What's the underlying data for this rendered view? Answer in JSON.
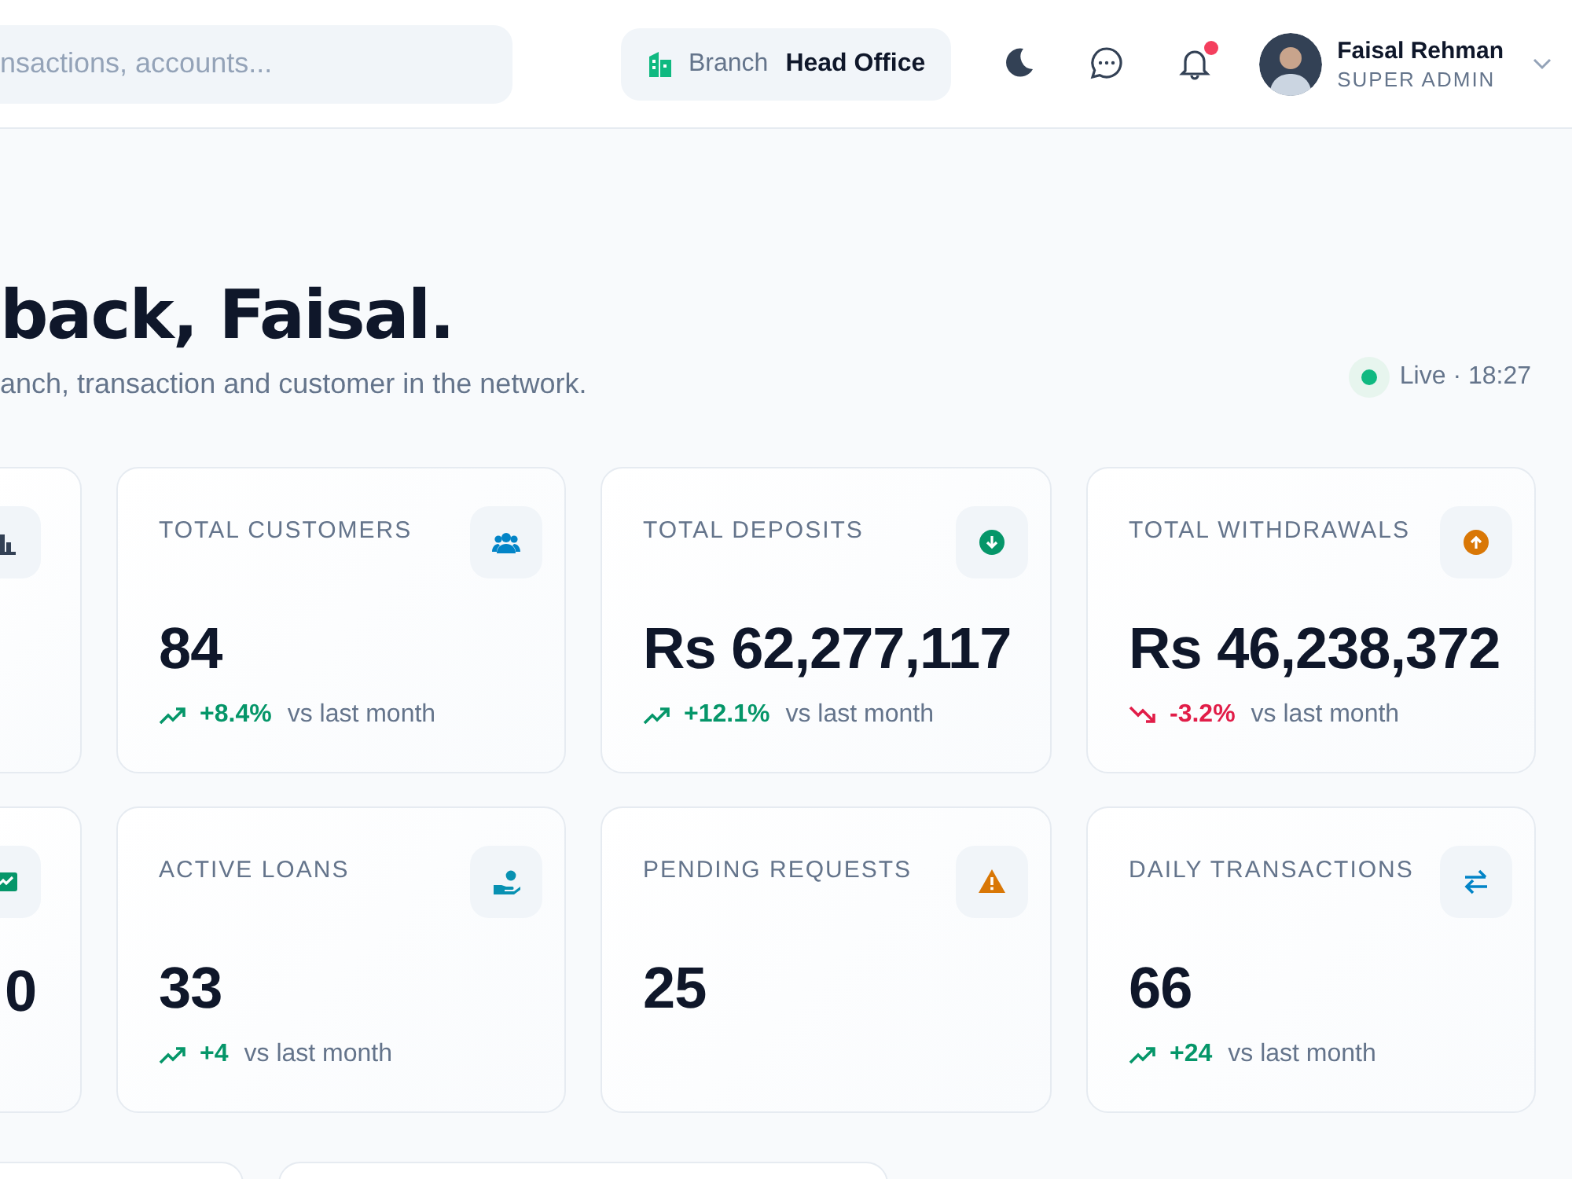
{
  "header": {
    "search": {
      "placeholder": "nsactions, accounts..."
    },
    "branch": {
      "label": "Branch",
      "value": "Head Office"
    },
    "notifications": {
      "unread": true
    },
    "user": {
      "name": "Faisal Rehman",
      "role": "SUPER ADMIN"
    }
  },
  "greeting": {
    "title": "back, Faisal.",
    "subtitle": "anch, transaction and customer in the network.",
    "live": "Live · 18:27"
  },
  "stats": [
    {
      "kind": "partial"
    },
    {
      "kind": "full",
      "title": "TOTAL CUSTOMERS",
      "value": "84",
      "trend": {
        "kind": "up",
        "delta": "+8.4%",
        "text": "vs last month"
      }
    },
    {
      "kind": "full",
      "title": "TOTAL DEPOSITS",
      "value": "Rs 62,277,117",
      "trend": {
        "kind": "up",
        "delta": "+12.1%",
        "text": "vs last month"
      }
    },
    {
      "kind": "full",
      "title": "TOTAL WITHDRAWALS",
      "value": "Rs 46,238,372",
      "trend": {
        "kind": "down",
        "delta": "-3.2%",
        "text": "vs last month"
      }
    },
    {
      "kind": "partial",
      "value": "0"
    },
    {
      "kind": "full",
      "title": "ACTIVE LOANS",
      "value": "33",
      "trend": {
        "kind": "up",
        "delta": "+4",
        "text": "vs last month"
      }
    },
    {
      "kind": "full",
      "title": "PENDING REQUESTS",
      "value": "25"
    },
    {
      "kind": "full",
      "title": "DAILY TRANSACTIONS",
      "value": "66",
      "trend": {
        "kind": "up",
        "delta": "+24",
        "text": "vs last month"
      }
    }
  ]
}
